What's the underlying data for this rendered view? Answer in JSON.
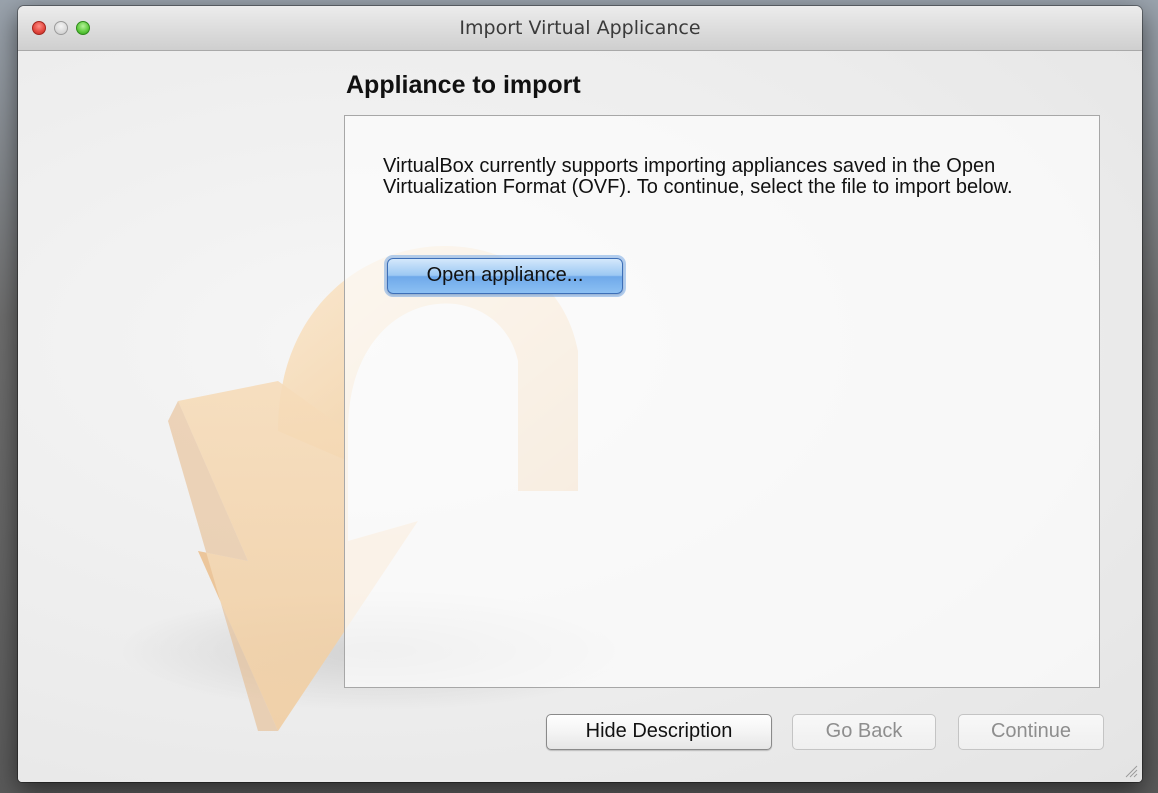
{
  "window": {
    "title": "Import Virtual Applicance"
  },
  "page": {
    "heading": "Appliance to import",
    "description": "VirtualBox currently supports importing appliances saved in the Open Virtualization Format (OVF). To continue, select the file to import below.",
    "open_button_label": "Open appliance..."
  },
  "footer": {
    "hide_description_label": "Hide Description",
    "go_back_label": "Go Back",
    "continue_label": "Continue"
  },
  "icons": {
    "close": "close-icon",
    "minimize": "minimize-icon",
    "zoom": "zoom-icon",
    "watermark": "import-arrow-icon",
    "resize": "resize-grip-icon"
  },
  "colors": {
    "accent_button": "#8cc0f3",
    "close": "#e2463d",
    "zoom": "#5cc93b",
    "watermark": "#f2d2a8"
  }
}
